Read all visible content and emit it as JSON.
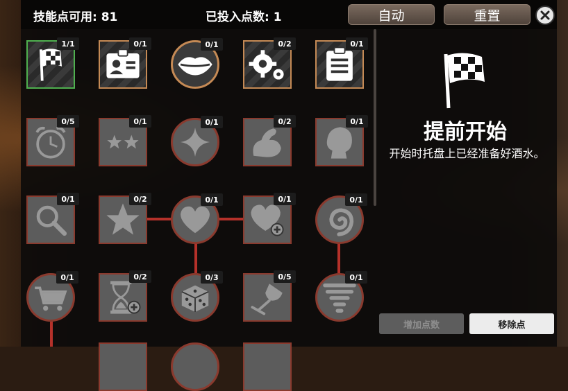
{
  "header": {
    "skill_points": "技能点可用: 81",
    "points_spent": "已投入点数: 1",
    "auto_label": "自动",
    "reset_label": "重置"
  },
  "skills": [
    {
      "icon": "checkered-flag-icon",
      "level": "1/1"
    },
    {
      "icon": "id-badge-icon",
      "level": "0/1"
    },
    {
      "icon": "lips-icon",
      "level": "0/1"
    },
    {
      "icon": "gears-icon",
      "level": "0/2"
    },
    {
      "icon": "clipboard-icon",
      "level": "0/1"
    },
    {
      "icon": "alarm-clock-icon",
      "level": "0/5"
    },
    {
      "icon": "two-stars-icon",
      "level": "0/1"
    },
    {
      "icon": "sparkle-icon",
      "level": "0/1"
    },
    {
      "icon": "flexed-arm-icon",
      "level": "0/2"
    },
    {
      "icon": "head-silhouette-icon",
      "level": "0/1"
    },
    {
      "icon": "magnifier-icon",
      "level": "0/1"
    },
    {
      "icon": "star-icon",
      "level": "0/2"
    },
    {
      "icon": "heart-icon",
      "level": "0/1"
    },
    {
      "icon": "heart-plus-icon",
      "level": "0/1"
    },
    {
      "icon": "spiral-icon",
      "level": "0/1"
    },
    {
      "icon": "shopping-cart-icon",
      "level": "0/1"
    },
    {
      "icon": "hourglass-plus-icon",
      "level": "0/2"
    },
    {
      "icon": "dice-icon",
      "level": "0/3"
    },
    {
      "icon": "wine-glass-icon",
      "level": "0/5"
    },
    {
      "icon": "tornado-icon",
      "level": "0/1"
    }
  ],
  "detail": {
    "icon": "checkered-flag-icon",
    "title": "提前开始",
    "description": "开始时托盘上已经准备好酒水。"
  },
  "actions": {
    "add_label": "增加点数",
    "remove_label": "移除点"
  }
}
